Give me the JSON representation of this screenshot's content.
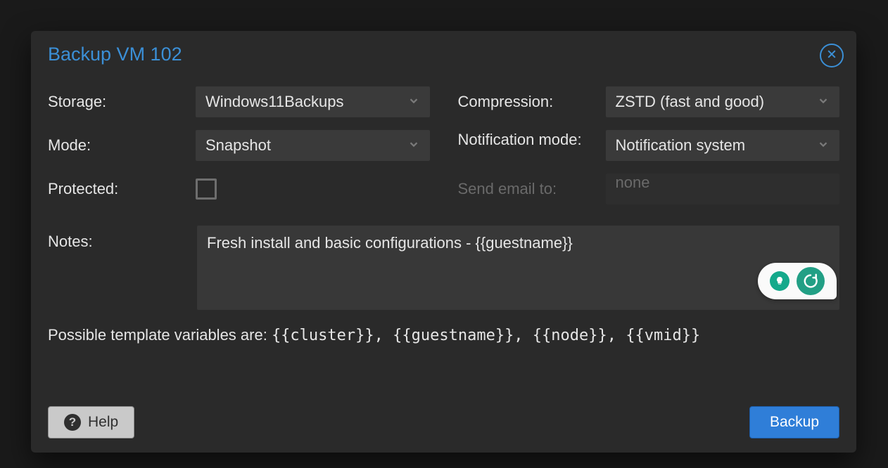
{
  "dialog": {
    "title": "Backup VM 102"
  },
  "left": {
    "storage_label": "Storage:",
    "storage_value": "Windows11Backups",
    "mode_label": "Mode:",
    "mode_value": "Snapshot",
    "protected_label": "Protected:"
  },
  "right": {
    "compression_label": "Compression:",
    "compression_value": "ZSTD (fast and good)",
    "notification_label": "Notification mode:",
    "notification_value": "Notification system",
    "email_label": "Send email to:",
    "email_value": "none"
  },
  "notes": {
    "label": "Notes:",
    "value": "Fresh install and basic configurations - {{guestname}}"
  },
  "template_hint": {
    "prefix": "Possible template variables are: ",
    "vars": "{{cluster}}, {{guestname}}, {{node}}, {{vmid}}"
  },
  "footer": {
    "help_label": "Help",
    "backup_label": "Backup"
  }
}
